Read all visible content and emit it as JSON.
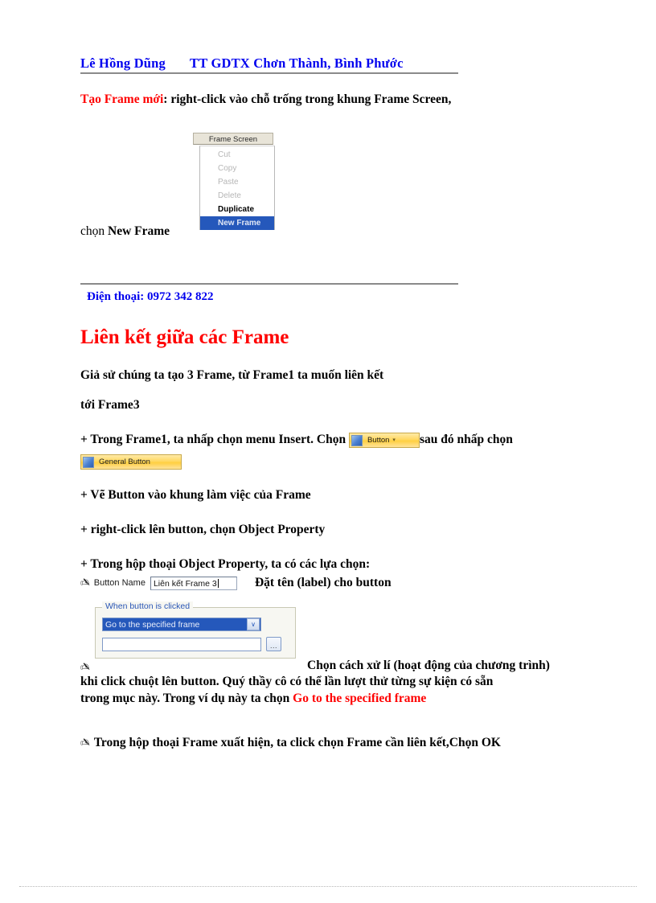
{
  "header": {
    "author": "Lê Hồng Dũng",
    "organization": "TT GDTX Chơn Thành, Bình Phước"
  },
  "sections": {
    "create_frame": {
      "label_red": "Tạo Frame mới",
      "text_after": ": right-click vào chỗ trống trong khung ",
      "bold_term": "Frame Screen",
      "trailing": ","
    },
    "choose_line": {
      "prefix": "chọn ",
      "bold": "New Frame"
    }
  },
  "context_menu": {
    "tab_title": "Frame Screen",
    "items": [
      {
        "label": "Cut",
        "state": "disabled"
      },
      {
        "label": "Copy",
        "state": "disabled"
      },
      {
        "label": "Paste",
        "state": "disabled"
      },
      {
        "label": "Delete",
        "state": "disabled"
      },
      {
        "label": "Duplicate",
        "state": "enabled"
      },
      {
        "label": "New Frame",
        "state": "selected"
      }
    ],
    "selected_color": "#2558bb"
  },
  "footer_block": {
    "phone": "Điện thoại: 0972 342 822"
  },
  "link_section": {
    "title": "Liên kết giữa các Frame",
    "title_color": "#ff0000",
    "para1_line1": "Giả sử chúng ta tạo 3 Frame, từ Frame1  ta muốn liên kết",
    "para1_line2": "tới Frame3",
    "step_insert_pre": "+ Trong Frame1, ta nhấp chọn menu Insert. Chọn ",
    "step_insert_post": "sau đó nhấp chọn",
    "step_draw": "+ Vẽ Button vào khung làm việc của Frame",
    "step_rightclick": "+ right-click lên button, chọn Object Property",
    "step_dialog": "+ Trong hộp thoại Object Property, ta có các lựa chọn:"
  },
  "toolbar_chips": {
    "button_chip": "Button",
    "general_button_chip": "General Button",
    "caret_glyph": "▾"
  },
  "object_property": {
    "button_name_label": "Button Name",
    "button_name_value": "Liên kết Frame 3",
    "note": "Đặt tên (label) cho button",
    "group_legend": "When button is clicked",
    "combo_selected": "Go to the specified frame",
    "combo_arrow_glyph": "∨",
    "path_value": "",
    "browse_label": "...",
    "description_line1": "Chọn cách xử lí (hoạt động của chương trình)",
    "description_line2": "khi click chuột lên button. Quý thầy cô có thể lần lượt thử từng sự kiện có sẵn",
    "description_line3_pre": "trong mục này. Trong ví dụ này ta chọn ",
    "description_line3_red": "Go to the specified frame",
    "final_step": "Trong hộp thoại Frame xuất hiện, ta click chọn Frame  cần liên kết,Chọn OK"
  },
  "glyphs": {
    "wingding_bullet": "✍"
  }
}
